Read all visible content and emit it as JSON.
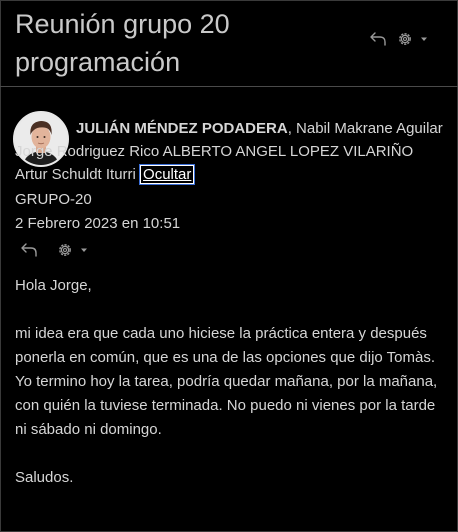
{
  "subject": "Reunión grupo 20 programación",
  "header_actions": {
    "reply_icon": "reply-icon",
    "settings_icon": "gear-icon",
    "dropdown_icon": "chevron-down-icon"
  },
  "message": {
    "sender": "JULIÁN MÉNDEZ PODADERA",
    "recipients_text": ", Nabil Makrane Aguilar Jorge Rodriguez Rico ALBERTO ANGEL LOPEZ VILARIÑO Artur Schuldt Iturri ",
    "hide_label": "Ocultar",
    "group": "GRUPO-20",
    "date": "2 Febrero 2023 en 10:51"
  },
  "body": {
    "greeting": "Hola Jorge,",
    "paragraph": "mi idea era que cada uno hiciese la práctica entera y después ponerla en común, que es una de las opciones que dijo Tomàs. Yo termino hoy la tarea, podría quedar mañana, por la mañana, con quién la tuviese terminada. No puedo ni vienes por la tarde ni sábado ni domingo.",
    "closing": "Saludos."
  },
  "colors": {
    "background": "#000000",
    "text": "#d6d6d6",
    "subject": "#c9c9c9",
    "focus_ring": "#3b6fd8"
  }
}
